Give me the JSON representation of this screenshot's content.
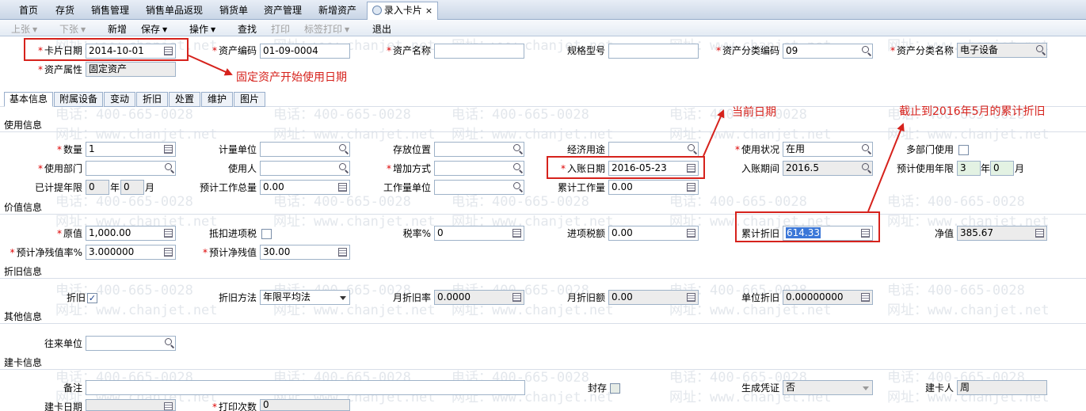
{
  "tabs": [
    {
      "label": "首页"
    },
    {
      "label": "存货"
    },
    {
      "label": "销售管理"
    },
    {
      "label": "销售单品返现"
    },
    {
      "label": "销货单"
    },
    {
      "label": "资产管理"
    },
    {
      "label": "新增资产"
    },
    {
      "label": "录入卡片",
      "close": "×"
    }
  ],
  "toolbar": {
    "prev": "上张",
    "next": "下张",
    "add": "新增",
    "save": "保存",
    "operate": "操作",
    "find": "查找",
    "print": "打印",
    "label_print": "标签打印",
    "exit": "退出"
  },
  "header": {
    "card_date_label": "卡片日期",
    "card_date": "2014-10-01",
    "asset_code_label": "资产编码",
    "asset_code": "01-09-0004",
    "asset_name_label": "资产名称",
    "asset_name": "",
    "spec_label": "规格型号",
    "spec": "",
    "category_code_label": "资产分类编码",
    "category_code": "09",
    "category_name_label": "资产分类名称",
    "category_name": "电子设备",
    "attribute_label": "资产属性",
    "attribute": "固定资产"
  },
  "subtabs": [
    "基本信息",
    "附属设备",
    "变动",
    "折旧",
    "处置",
    "维护",
    "图片"
  ],
  "usage": {
    "section": "使用信息",
    "quantity_label": "数量",
    "quantity": "1",
    "unit_label": "计量单位",
    "unit": "",
    "location_label": "存放位置",
    "location": "",
    "purpose_label": "经济用途",
    "purpose": "",
    "status_label": "使用状况",
    "status": "在用",
    "multi_dept_label": "多部门使用",
    "dept_label": "使用部门",
    "dept": "",
    "user_label": "使用人",
    "user": "",
    "add_method_label": "增加方式",
    "add_method": "",
    "entry_date_label": "入账日期",
    "entry_date": "2016-05-23",
    "entry_period_label": "入账期间",
    "entry_period": "2016.5",
    "life_label": "预计使用年限",
    "life_years": "3",
    "life_months": "0",
    "year_unit": "年",
    "month_unit": "月",
    "used_label": "已计提年限",
    "used_years": "0",
    "used_months": "0",
    "workload_label": "预计工作总量",
    "workload": "0.00",
    "work_unit_label": "工作量单位",
    "work_unit": "",
    "cum_work_label": "累计工作量",
    "cum_work": "0.00"
  },
  "value": {
    "section": "价值信息",
    "original_label": "原值",
    "original": "1,000.00",
    "deduct_label": "抵扣进项税",
    "tax_rate_label": "税率%",
    "tax_rate": "0",
    "input_tax_label": "进项税额",
    "input_tax": "0.00",
    "acc_dep_label": "累计折旧",
    "acc_dep": "614.33",
    "net_label": "净值",
    "net": "385.67",
    "salvage_rate_label": "预计净残值率%",
    "salvage_rate": "3.000000",
    "salvage_label": "预计净残值",
    "salvage": "30.00"
  },
  "depreciation": {
    "section": "折旧信息",
    "dep_label": "折旧",
    "dep_checked": "✓",
    "method_label": "折旧方法",
    "method": "年限平均法",
    "monthly_rate_label": "月折旧率",
    "monthly_rate": "0.0000",
    "monthly_amount_label": "月折旧额",
    "monthly_amount": "0.00",
    "unit_dep_label": "单位折旧",
    "unit_dep": "0.00000000"
  },
  "other": {
    "section": "其他信息",
    "partner_label": "往来单位",
    "partner": ""
  },
  "build": {
    "section": "建卡信息",
    "note_label": "备注",
    "note": "",
    "sealed_label": "封存",
    "voucher_label": "生成凭证",
    "voucher": "否",
    "creator_label": "建卡人",
    "creator": "周",
    "build_date_label": "建卡日期",
    "build_date": "",
    "print_count_label": "打印次数",
    "print_count": "0"
  },
  "annotations": {
    "start_date_note": "固定资产开始使用日期",
    "current_date_note": "当前日期",
    "acc_dep_note": "截止到2016年5月的累计折旧"
  },
  "watermark": {
    "phone": "电话：400-665-0028",
    "site": "网址：www.chanjet.net"
  },
  "colors": {
    "annotation": "#d6221c",
    "selection": "#3b77d8",
    "required": "#dd0000"
  }
}
